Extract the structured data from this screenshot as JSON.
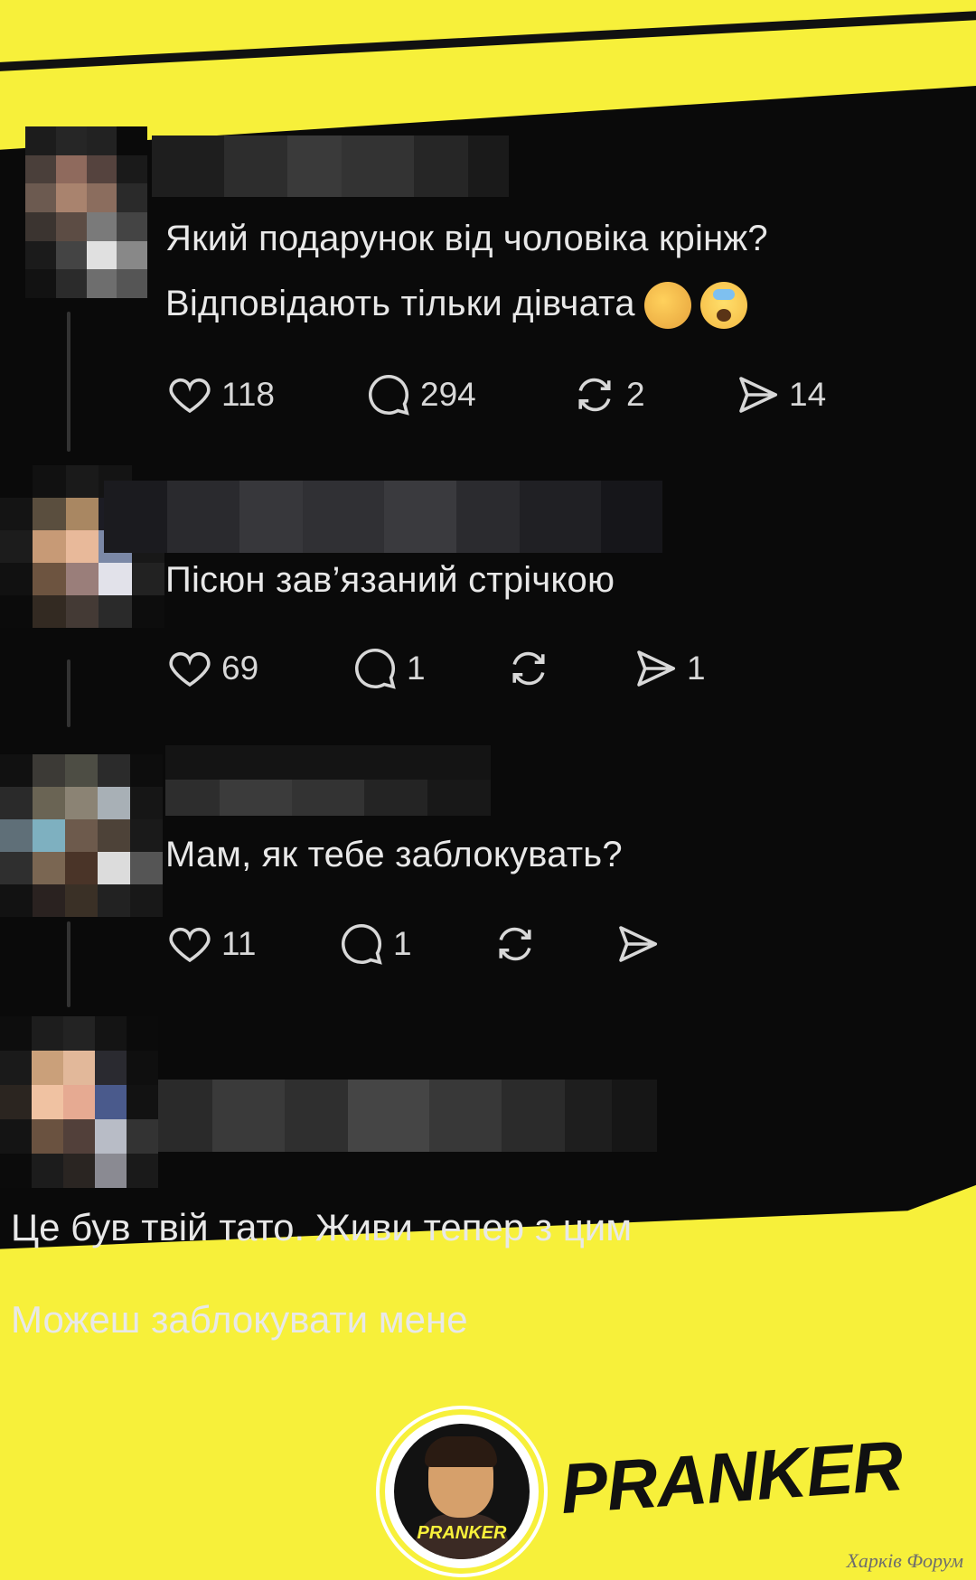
{
  "posts": [
    {
      "text_line1": "Який подарунок від чоловіка крінж?",
      "text_line2": "Відповідають тільки дівчата",
      "emoji1": "ok-hand-emoji",
      "emoji2": "shocked-face-emoji",
      "likes": "118",
      "comments": "294",
      "reposts": "2",
      "shares": "14"
    },
    {
      "text_line1": "Пісюн зав’язаний стрічкою",
      "likes": "69",
      "comments": "1",
      "reposts": "",
      "shares": "1"
    },
    {
      "text_line1": "Мам, як тебе заблокувать?",
      "likes": "11",
      "comments": "1",
      "reposts": "",
      "shares": ""
    }
  ],
  "reply": {
    "line1": "Це був твій тато. Живи тепер з цим",
    "line2": "Можеш заблокувати мене"
  },
  "brand": {
    "logo_small": "PRANKER",
    "banner": "PRANKER"
  },
  "watermark": "Харків Форум",
  "colors": {
    "accent_yellow": "#f7f03a",
    "background_dark": "#0a0a0a",
    "text_light": "#e8e8e8"
  }
}
